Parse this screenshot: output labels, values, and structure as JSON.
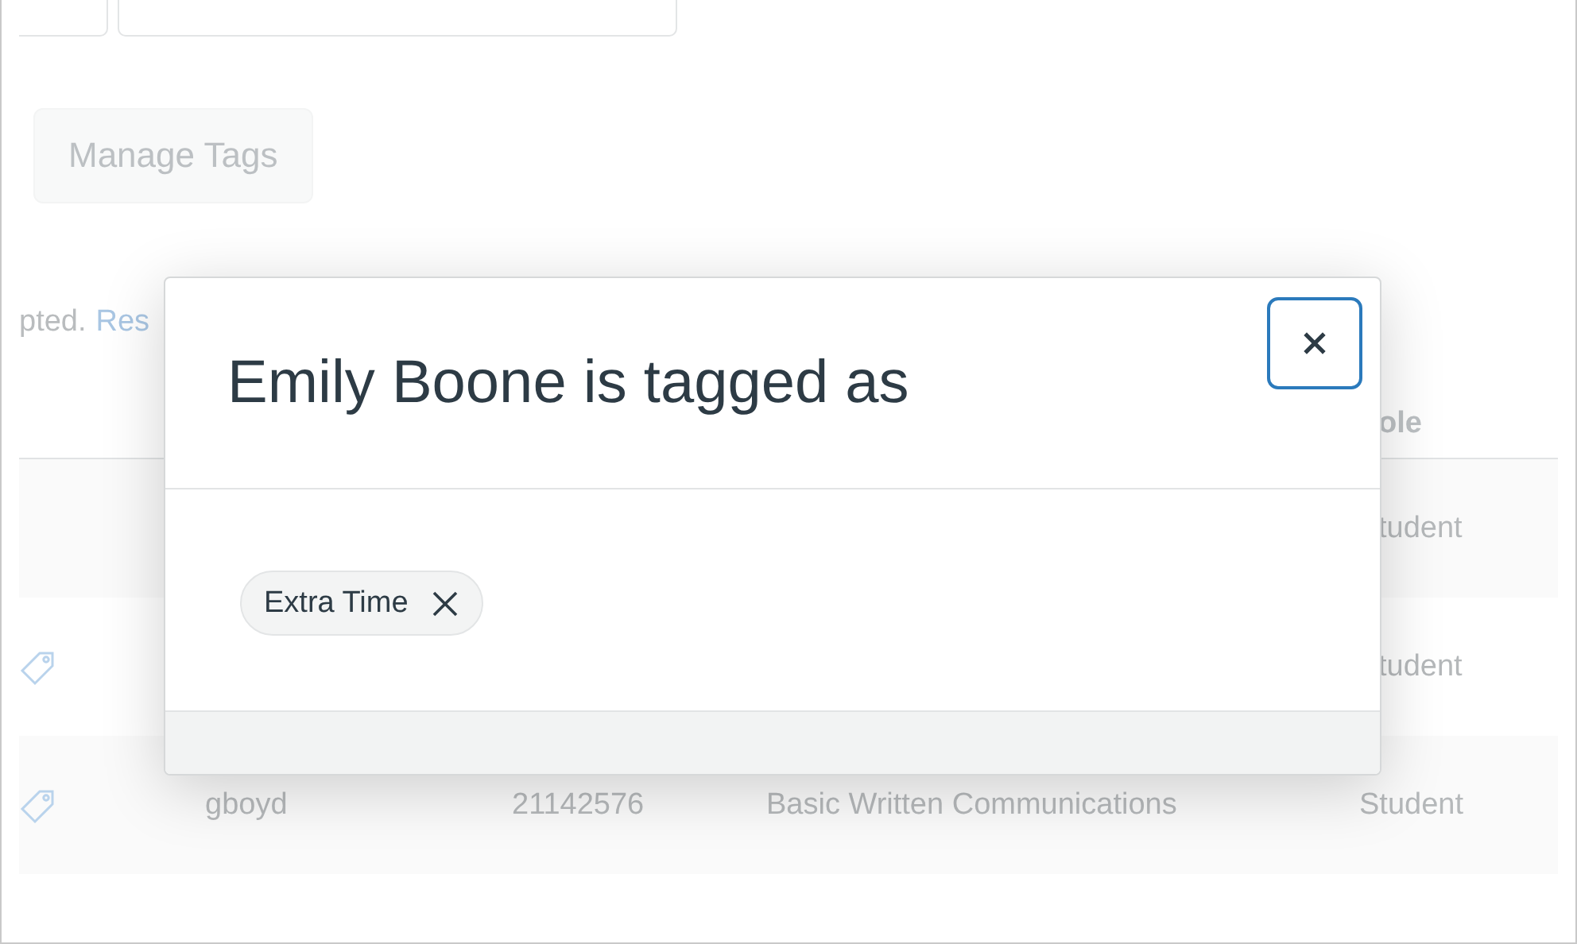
{
  "manage_tags_button": {
    "label": "Manage Tags"
  },
  "notice": {
    "text": "pted.",
    "link": "Res"
  },
  "table": {
    "columns": [
      {
        "label": "ole"
      }
    ],
    "rows": [
      {
        "tagged": false,
        "role": "tudent"
      },
      {
        "tagged": true,
        "role": "tudent"
      },
      {
        "tagged": true,
        "login": "gboyd",
        "sis_id": "21142576",
        "section": "Basic Written Communications",
        "role": "Student"
      }
    ]
  },
  "modal": {
    "title": "Emily Boone is tagged as",
    "tags": [
      {
        "label": "Extra Time"
      }
    ]
  }
}
